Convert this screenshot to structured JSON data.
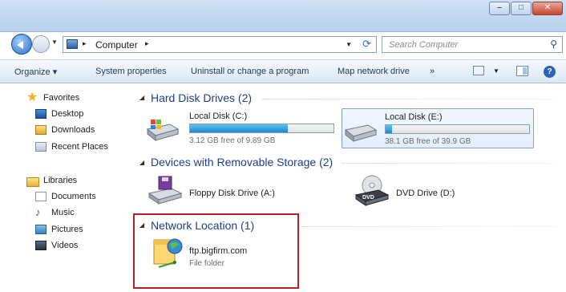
{
  "window": {
    "caption": {
      "minimize": "–",
      "maximize": "□",
      "close": "✕"
    }
  },
  "address": {
    "crumb": "Computer",
    "separator": "▸",
    "search_placeholder": "Search Computer"
  },
  "commands": {
    "organize": "Organize ▾",
    "system_properties": "System properties",
    "uninstall": "Uninstall or change a program",
    "map_drive": "Map network drive",
    "more": "»",
    "help": "?"
  },
  "nav": {
    "favorites": "Favorites",
    "desktop": "Desktop",
    "downloads": "Downloads",
    "recent": "Recent Places",
    "libraries": "Libraries",
    "documents": "Documents",
    "music": "Music",
    "pictures": "Pictures",
    "videos": "Videos"
  },
  "groups": {
    "hdd": {
      "title": "Hard Disk Drives (2)",
      "drives": [
        {
          "name": "Local Disk (C:)",
          "free": "3.12 GB free of 9.89 GB",
          "used_fraction": 0.68
        },
        {
          "name": "Local Disk (E:)",
          "free": "38.1 GB free of 39.9 GB",
          "used_fraction": 0.045
        }
      ]
    },
    "removable": {
      "title": "Devices with Removable Storage (2)",
      "floppy": "Floppy Disk Drive (A:)",
      "dvd": "DVD Drive (D:)",
      "dvd_label": "DVD"
    },
    "network": {
      "title": "Network Location (1)",
      "name": "ftp.bigfirm.com",
      "type": "File folder"
    }
  },
  "colors": {
    "group_title": "#1e3f8a",
    "highlight": "#b22424",
    "bar_fill": "#1f86cd"
  }
}
